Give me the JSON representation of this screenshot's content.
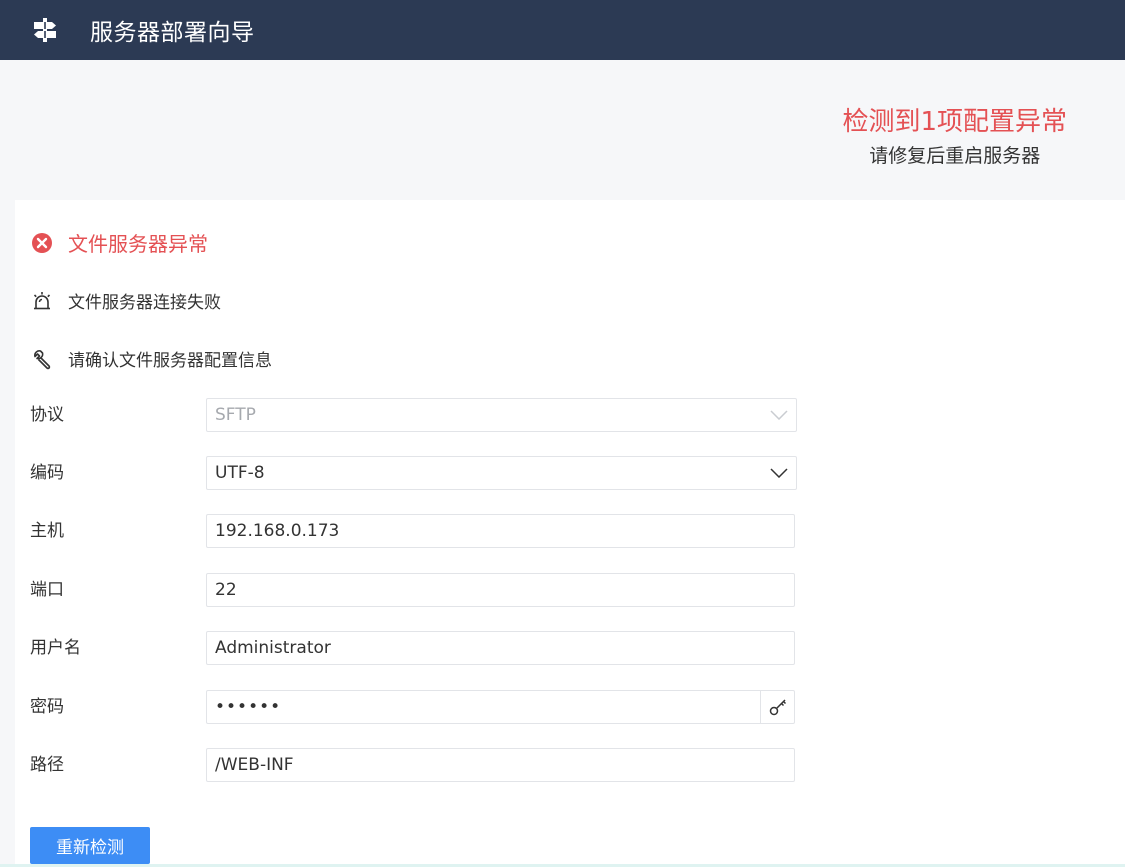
{
  "header": {
    "title": "服务器部署向导",
    "logo_icon": "signpost-icon",
    "background": "#2c3a54"
  },
  "summary": {
    "headline": "检测到1项配置异常",
    "subtext": "请修复后重启服务器"
  },
  "issue": {
    "title": "文件服务器异常",
    "title_icon": "error-circle-icon",
    "detail": "文件服务器连接失败",
    "detail_icon": "alarm-icon",
    "hint": "请确认文件服务器配置信息",
    "hint_icon": "wrench-icon"
  },
  "form": {
    "protocol": {
      "label": "协议",
      "value": "SFTP",
      "disabled": true
    },
    "encoding": {
      "label": "编码",
      "value": "UTF-8"
    },
    "host": {
      "label": "主机",
      "value": "192.168.0.173"
    },
    "port": {
      "label": "端口",
      "value": "22"
    },
    "username": {
      "label": "用户名",
      "value": "Administrator"
    },
    "password": {
      "label": "密码",
      "value": "••••••",
      "reveal_icon": "key-icon"
    },
    "path": {
      "label": "路径",
      "value": "/WEB-INF"
    }
  },
  "actions": {
    "recheck_label": "重新检测"
  },
  "colors": {
    "error": "#e45154",
    "primary": "#3d8df5"
  }
}
